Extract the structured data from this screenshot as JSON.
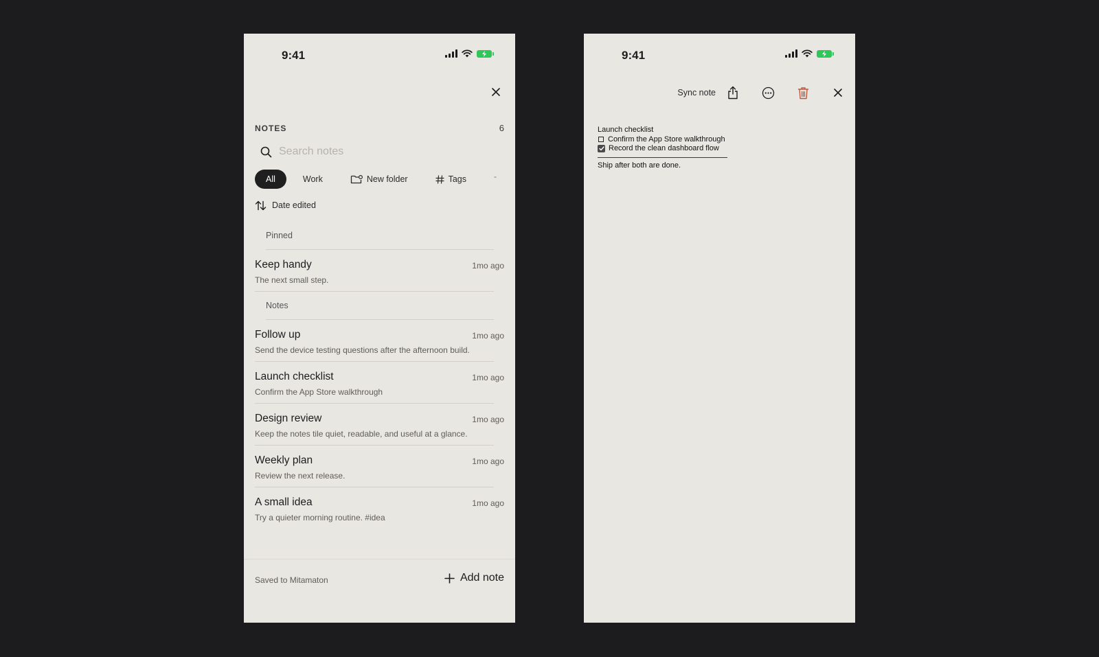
{
  "left_screen": {
    "status_time": "9:41",
    "notes_heading": "NOTES",
    "notes_count": "6",
    "search_placeholder": "Search notes",
    "chips": {
      "all": "All",
      "work": "Work",
      "new_folder": "New folder",
      "tags": "Tags",
      "more": "-"
    },
    "sort_label": "Date edited",
    "sections": {
      "pinned": "Pinned",
      "notes": "Notes"
    },
    "pinned_notes": [
      {
        "title": "Keep handy",
        "time": "1mo ago",
        "preview": "The next small step."
      }
    ],
    "notes": [
      {
        "title": "Follow up",
        "time": "1mo ago",
        "preview": "Send the device testing questions after the afternoon build."
      },
      {
        "title": "Launch checklist",
        "time": "1mo ago",
        "preview": "Confirm the App Store walkthrough"
      },
      {
        "title": "Design review",
        "time": "1mo ago",
        "preview": "Keep the notes tile quiet, readable, and useful at a glance."
      },
      {
        "title": "Weekly plan",
        "time": "1mo ago",
        "preview": "Review the next release."
      },
      {
        "title": "A small idea",
        "time": "1mo ago",
        "preview": "Try a quieter morning routine. #idea"
      }
    ],
    "footer_status": "Saved to Mitamaton",
    "add_note_label": "Add note"
  },
  "right_screen": {
    "status_time": "9:41",
    "sync_label": "Sync note",
    "document": {
      "title": "Launch checklist",
      "items": [
        {
          "text": "Confirm the App Store walkthrough",
          "checked": false
        },
        {
          "text": "Record the clean dashboard flow",
          "checked": true
        }
      ],
      "footer": "Ship after both are done."
    }
  },
  "colors": {
    "background": "#1c1c1e",
    "screen": "#e9e7e1",
    "chip_active": "#1f1f1f",
    "battery": "#2fc75a",
    "delete": "#c0573e"
  },
  "icons": [
    "signal-icon",
    "wifi-icon",
    "battery-icon",
    "close-icon",
    "search-icon",
    "folder-icon",
    "hash-icon",
    "sort-icon",
    "plus-icon",
    "share-icon",
    "more-icon",
    "trash-icon"
  ]
}
